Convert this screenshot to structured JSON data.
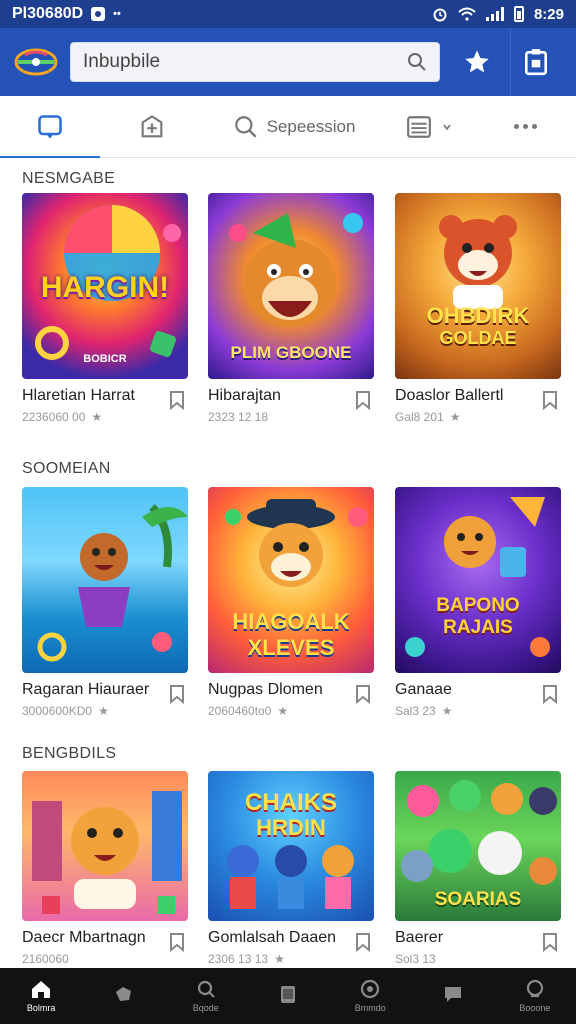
{
  "status_bar": {
    "carrier": "Pl30680D",
    "time": "8:29"
  },
  "app_bar": {
    "search_placeholder": "Inbupbile"
  },
  "tabs": [
    {
      "label": ""
    },
    {
      "label": ""
    },
    {
      "label": "Sepeession"
    },
    {
      "label": ""
    },
    {
      "label": ""
    }
  ],
  "sections": [
    {
      "title": "NESMGABE",
      "items": [
        {
          "title": "Hlaretian Harrat",
          "meta": "2236060 00",
          "art_text": "HARGIN!",
          "art_sub": "BOBICR"
        },
        {
          "title": "Hibarajtan",
          "meta": "2323 12 18",
          "art_text": "PLIM GBOONE",
          "art_sub": ""
        },
        {
          "title": "Doaslor Ballertl",
          "meta": "Gal8 201",
          "art_text": "OHBDIRK",
          "art_sub": "GOLDAE"
        }
      ]
    },
    {
      "title": "SOOMEIAN",
      "items": [
        {
          "title": "Ragaran Hiauraer",
          "meta": "3000600KD0",
          "art_text": "",
          "art_sub": ""
        },
        {
          "title": "Nugpas Dlomen",
          "meta": "2060460to0",
          "art_text": "HIAGOALK",
          "art_sub": "XLEVES"
        },
        {
          "title": "Ganaae",
          "meta": "Sal3 23",
          "art_text": "BAPONO",
          "art_sub": "RAJAIS"
        }
      ]
    },
    {
      "title": "BENGBDILS",
      "items": [
        {
          "title": "Daecr Mbartnagn",
          "meta": "2160060",
          "art_text": "",
          "art_sub": ""
        },
        {
          "title": "Gomlalsah Daaen",
          "meta": "2306 13 13",
          "art_text": "CHAIKS",
          "art_sub": "HRDIN"
        },
        {
          "title": "Baerer",
          "meta": "Sol3 13",
          "art_text": "SOARIAS",
          "art_sub": ""
        }
      ]
    }
  ],
  "bottom_nav": [
    {
      "label": "Bolmra",
      "icon": "home-icon"
    },
    {
      "label": "",
      "icon": "shape-icon"
    },
    {
      "label": "Bqode",
      "icon": "search-icon"
    },
    {
      "label": "",
      "icon": "tablet-icon"
    },
    {
      "label": "Bmmdo",
      "icon": "disc-icon"
    },
    {
      "label": "",
      "icon": "chat-icon"
    },
    {
      "label": "Booone",
      "icon": "account-icon"
    }
  ],
  "colors": {
    "status_bar": "#1e3f8f",
    "app_bar": "#2452b6",
    "accent": "#2a6fd6",
    "bottom_nav": "#121212"
  }
}
